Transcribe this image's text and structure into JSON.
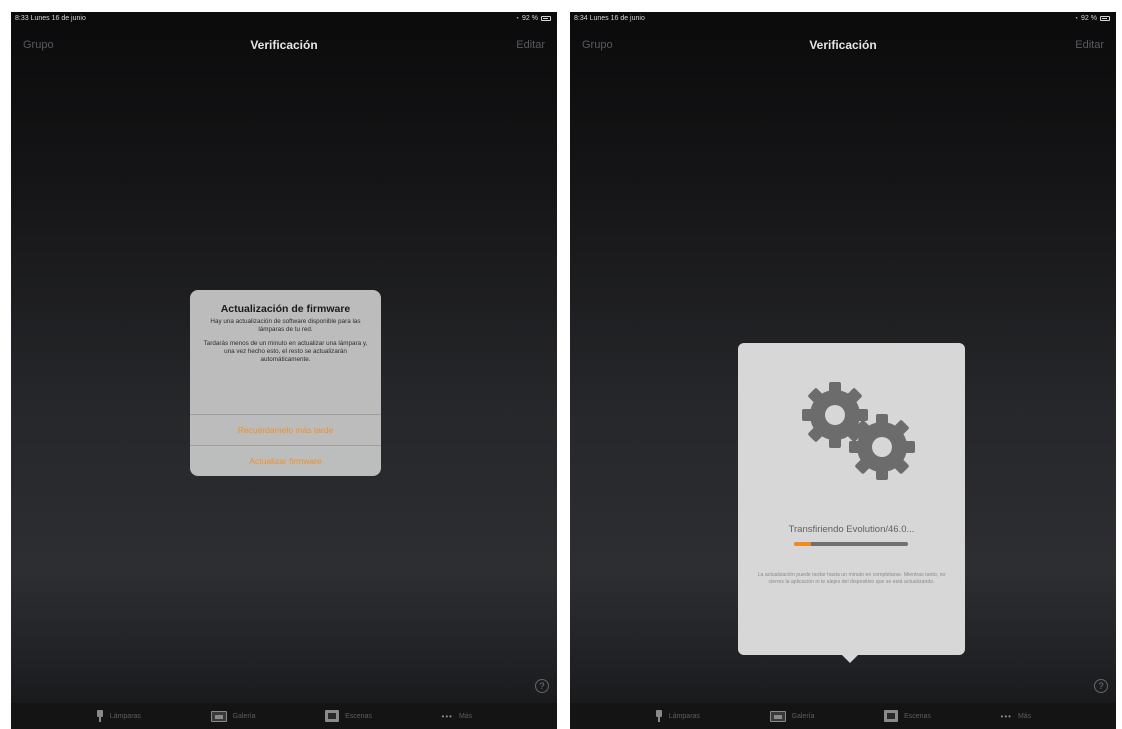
{
  "left": {
    "status": {
      "time_date": "8:33  Lunes 16 de junio",
      "battery": "92 %"
    },
    "nav": {
      "left": "Grupo",
      "title": "Verificación",
      "right": "Editar"
    },
    "alert": {
      "title": "Actualización de firmware",
      "message1": "Hay una actualización de software disponible para las lámparas de tu red.",
      "message2": "Tardarás menos de un minuto en actualizar una lámpara y, una vez hecho esto, el resto se actualizarán automáticamente.",
      "button_later": "Recuérdamelo más tarde",
      "button_update": "Actualizar firmware"
    },
    "tabs": [
      {
        "label": "Lámparas",
        "icon": "lamp-icon"
      },
      {
        "label": "Galería",
        "icon": "gallery-icon"
      },
      {
        "label": "Escenas",
        "icon": "scenes-icon"
      },
      {
        "label": "Más",
        "icon": "more-icon"
      }
    ]
  },
  "right": {
    "status": {
      "time_date": "8:34  Lunes 16 de junio",
      "battery": "92 %"
    },
    "nav": {
      "left": "Grupo",
      "title": "Verificación",
      "right": "Editar"
    },
    "update": {
      "icon": "gears-icon",
      "progress_text": "Transfiriendo Evolution/46.0...",
      "progress_fraction": 0.15,
      "message": "La actualización puede tardar hasta un minuto en completarse. Mientras tanto, no cierres la aplicación ni te alejes del dispositivo que se está actualizando."
    },
    "tabs": [
      {
        "label": "Lámparas",
        "icon": "lamp-icon"
      },
      {
        "label": "Galería",
        "icon": "gallery-icon"
      },
      {
        "label": "Escenas",
        "icon": "scenes-icon"
      },
      {
        "label": "Más",
        "icon": "more-icon"
      }
    ]
  },
  "colors": {
    "accent": "#ef8a22",
    "background": "#2a2b2e"
  }
}
